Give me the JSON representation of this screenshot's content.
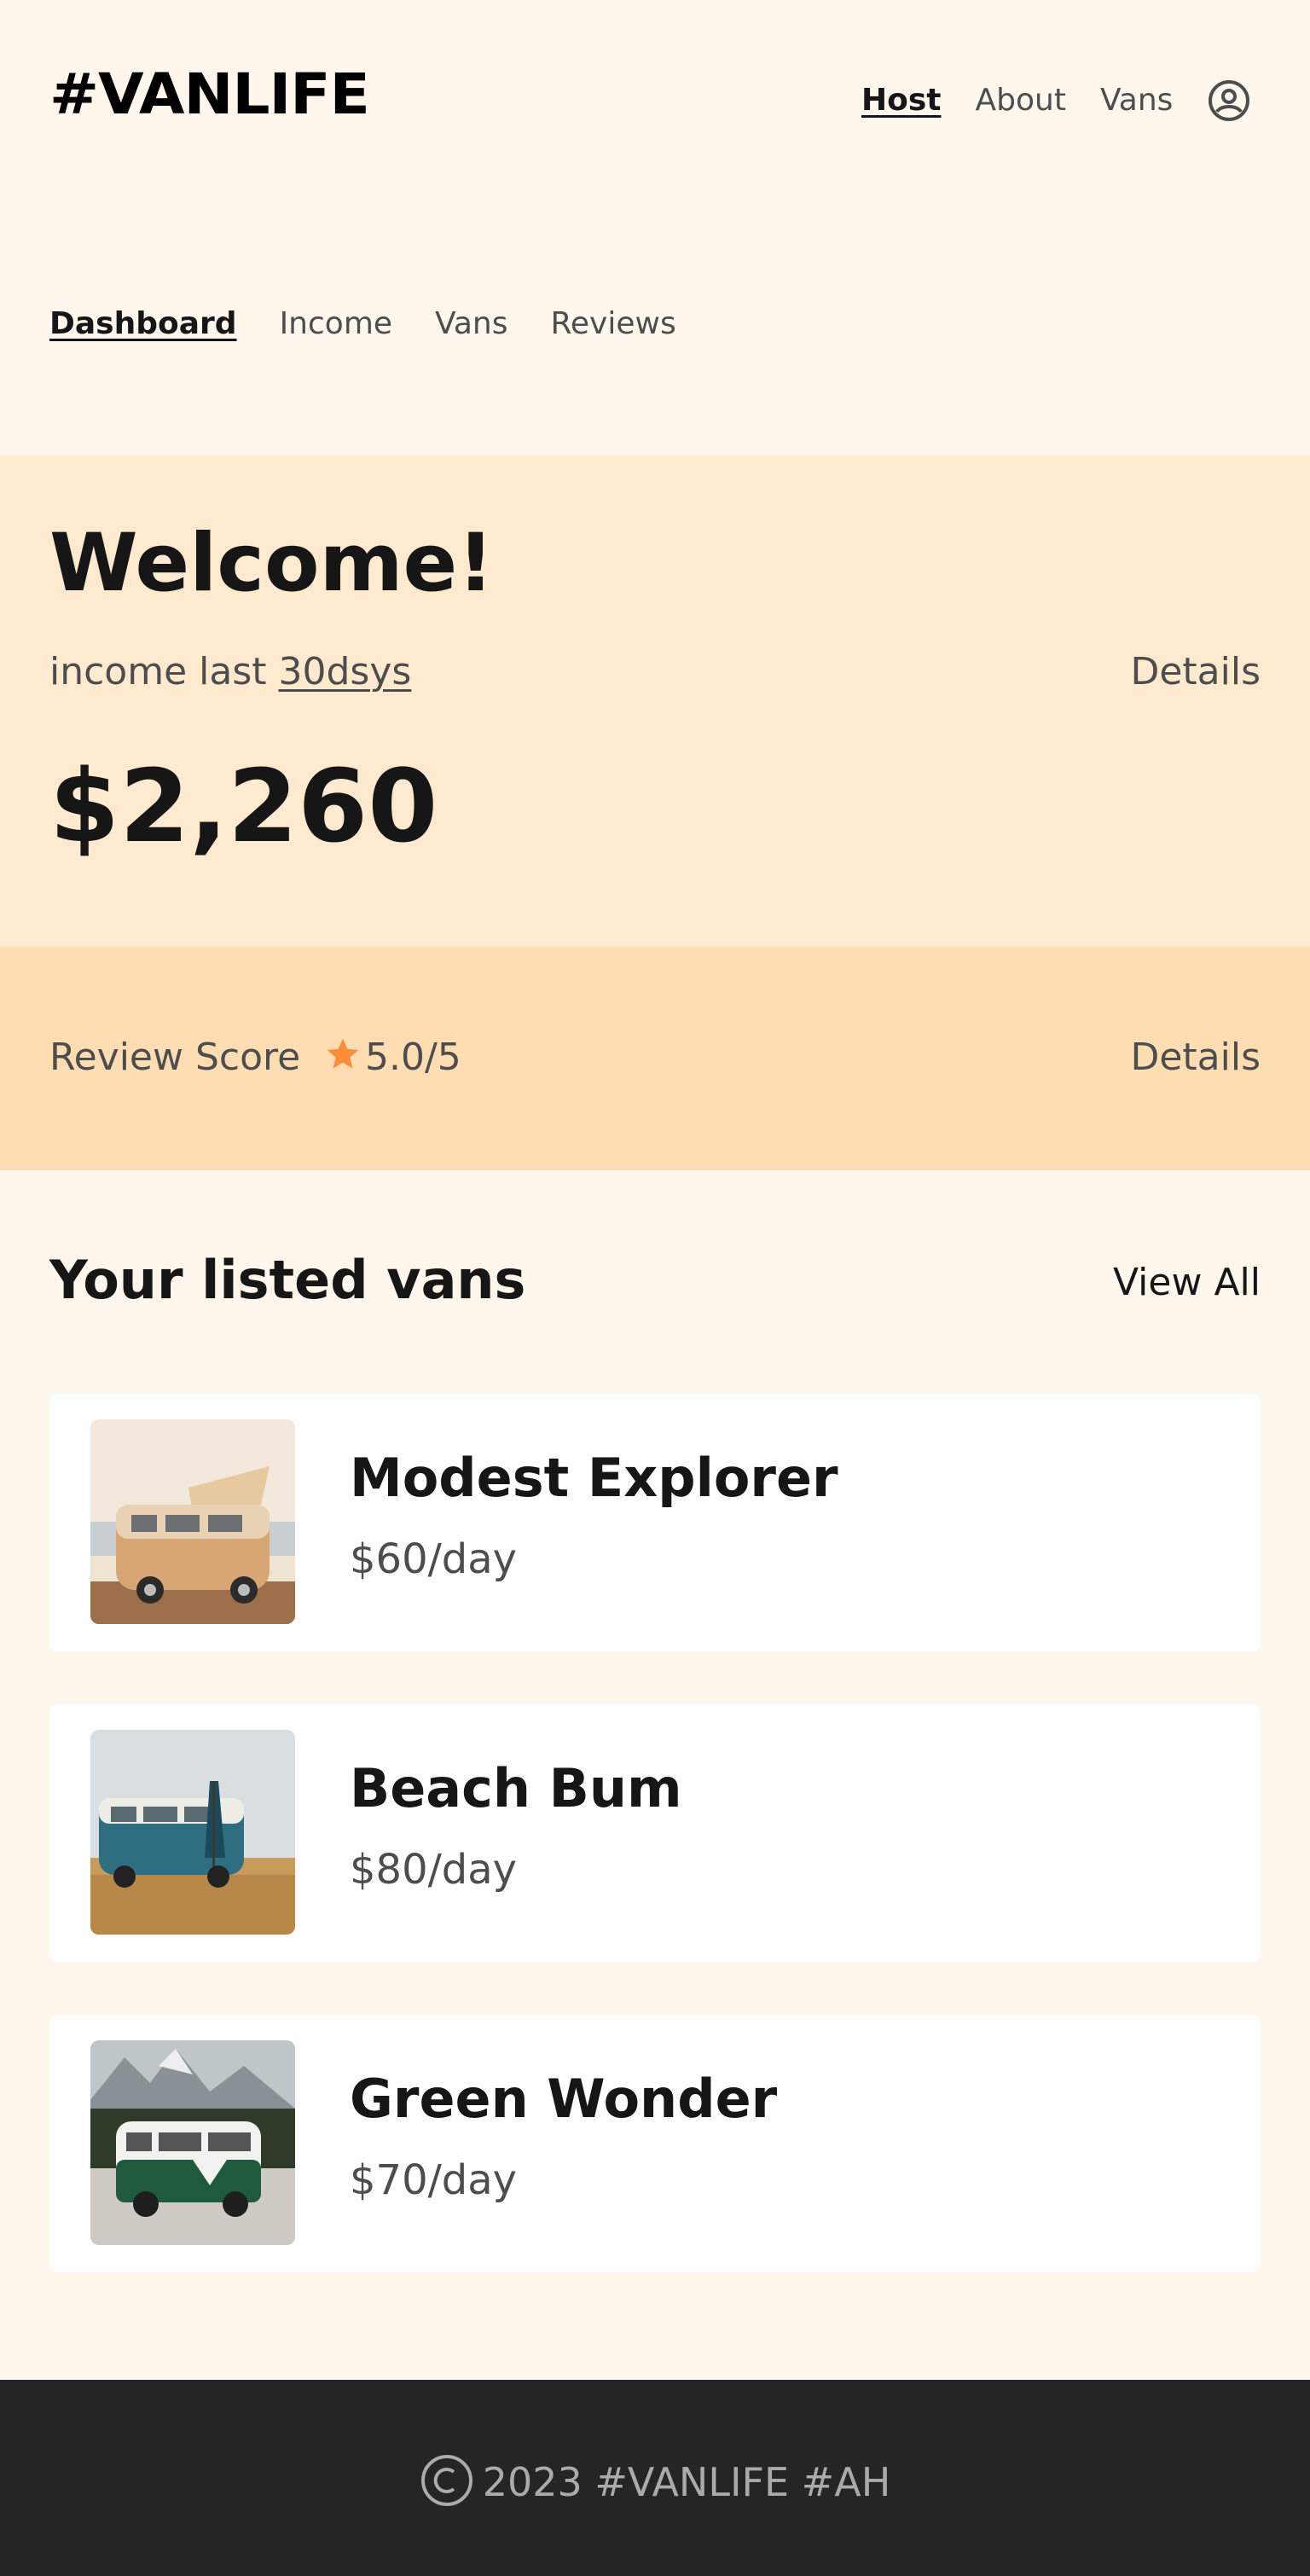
{
  "header": {
    "logo": "#VANLIFE",
    "nav": [
      {
        "label": "Host"
      },
      {
        "label": "About"
      },
      {
        "label": "Vans"
      }
    ],
    "user_icon": "user-circle-icon"
  },
  "host_nav": {
    "items": [
      {
        "label": "Dashboard"
      },
      {
        "label": "Income"
      },
      {
        "label": "Vans"
      },
      {
        "label": "Reviews"
      }
    ]
  },
  "welcome": {
    "title": "Welcome!",
    "income_prefix": "income last ",
    "income_period": "30dsys",
    "details_label": "Details",
    "amount": "$2,260"
  },
  "review": {
    "label": "Review Score",
    "score": "5.0/5",
    "details_label": "Details",
    "star_color": "#FF8C38"
  },
  "listed_vans": {
    "title": "Your listed vans",
    "view_all_label": "View All",
    "vans": [
      {
        "name": "Modest Explorer",
        "price": "$60/day"
      },
      {
        "name": "Beach Bum",
        "price": "$80/day"
      },
      {
        "name": "Green Wonder",
        "price": "$70/day"
      }
    ]
  },
  "footer": {
    "text": "2023 #VANLIFE #AH"
  },
  "colors": {
    "page_bg": "#FFF7ED",
    "welcome_bg": "#FFEAD0",
    "review_bg": "#FFDDB2",
    "footer_bg": "#252525"
  }
}
